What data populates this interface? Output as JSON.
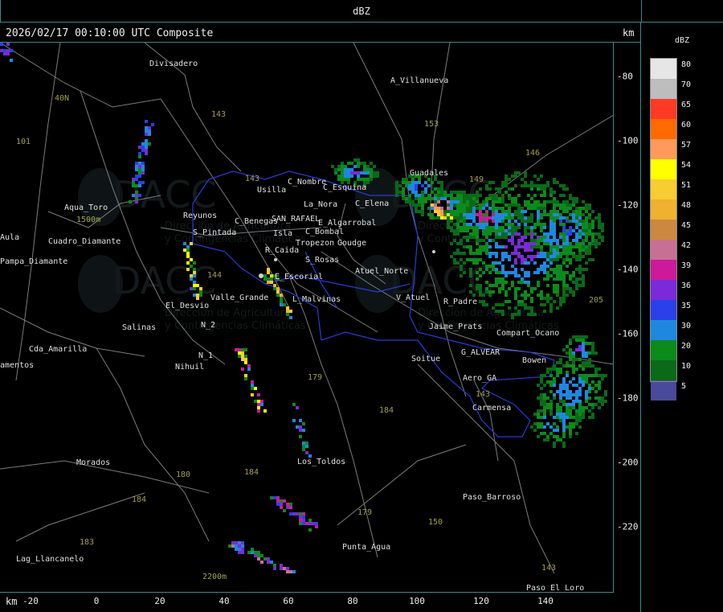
{
  "header": {
    "title": "dBZ"
  },
  "map": {
    "datestamp": "2026/02/17 00:10:00 UTC Composite",
    "unit_top": "km",
    "unit_bottom": "km",
    "x_ticks": [
      "-20",
      "0",
      "20",
      "40",
      "60",
      "80",
      "100",
      "120",
      "140"
    ],
    "y_ticks": [
      "-80",
      "-100",
      "-120",
      "-140",
      "-160",
      "-180",
      "-200",
      "-220"
    ],
    "places": [
      {
        "name": "Divisadero"
      },
      {
        "name": "A_Villanueva"
      },
      {
        "name": "Guadales"
      },
      {
        "name": "Usilla"
      },
      {
        "name": "C_Nombre"
      },
      {
        "name": "La_Nora"
      },
      {
        "name": "C_Esquina"
      },
      {
        "name": "C_Elena"
      },
      {
        "name": "Aqua_Toro"
      },
      {
        "name": "Reyunos"
      },
      {
        "name": "S_Pintada"
      },
      {
        "name": "C_Benegas"
      },
      {
        "name": "SAN_RAFAEL"
      },
      {
        "name": "E_Algarrobal"
      },
      {
        "name": "C_Bombal"
      },
      {
        "name": "Isla"
      },
      {
        "name": "Tropezon"
      },
      {
        "name": "Goudge"
      },
      {
        "name": "R_Caida"
      },
      {
        "name": "S_Rosas"
      },
      {
        "name": "Atuel_Norte"
      },
      {
        "name": "E_Escorial"
      },
      {
        "name": "Valle_Grande"
      },
      {
        "name": "L_Malvinas"
      },
      {
        "name": "El_Desvio"
      },
      {
        "name": "V_Atuel"
      },
      {
        "name": "R_Padre"
      },
      {
        "name": "Pampa_Diamante"
      },
      {
        "name": "Salinas"
      },
      {
        "name": "N_2"
      },
      {
        "name": "N_1"
      },
      {
        "name": "Nihuil"
      },
      {
        "name": "Cda_Amarilla"
      },
      {
        "name": "Soitue"
      },
      {
        "name": "G_ALVEAR"
      },
      {
        "name": "Bowen"
      },
      {
        "name": "Aero_GA"
      },
      {
        "name": "Carmensa"
      },
      {
        "name": "Compart_Ocano"
      },
      {
        "name": "Jaime_Prats"
      },
      {
        "name": "Morados"
      },
      {
        "name": "Los_Toldos"
      },
      {
        "name": "Paso_Barroso"
      },
      {
        "name": "Punta_Agua"
      },
      {
        "name": "Lag_Llancanelo"
      },
      {
        "name": "Paso_El_Loro"
      },
      {
        "name": "Aula"
      },
      {
        "name": "amentos"
      },
      {
        "name": "Cuadro_Diamante"
      }
    ],
    "elevations": [
      "143",
      "153",
      "146",
      "101",
      "40N",
      "143",
      "144",
      "149",
      "179",
      "184",
      "180",
      "184",
      "183",
      "184",
      "179",
      "150",
      "143",
      "143",
      "205",
      "2200m",
      "1500m"
    ],
    "watermark": {
      "brand": "DACC",
      "line1": "Dirección de Agricultura",
      "line2": "y Contingencias Climáticas"
    }
  },
  "legend": {
    "title": "dBZ",
    "levels": [
      {
        "label": "80",
        "color": "#e6e6e6"
      },
      {
        "label": "70",
        "color": "#bdbdbd"
      },
      {
        "label": "65",
        "color": "#ff3a24"
      },
      {
        "label": "60",
        "color": "#ff6a00"
      },
      {
        "label": "57",
        "color": "#ff9a5a"
      },
      {
        "label": "54",
        "color": "#ffff00"
      },
      {
        "label": "51",
        "color": "#f8cc33"
      },
      {
        "label": "48",
        "color": "#f0b030"
      },
      {
        "label": "45",
        "color": "#cc8840"
      },
      {
        "label": "42",
        "color": "#c87094"
      },
      {
        "label": "39",
        "color": "#cc1a9a"
      },
      {
        "label": "36",
        "color": "#7a2ad8"
      },
      {
        "label": "35",
        "color": "#2a40e8"
      },
      {
        "label": "30",
        "color": "#1e88e0"
      },
      {
        "label": "20",
        "color": "#0c8a1c"
      },
      {
        "label": "10",
        "color": "#0a6a18"
      },
      {
        "label": "5",
        "color": "#4a4a9a"
      }
    ]
  }
}
